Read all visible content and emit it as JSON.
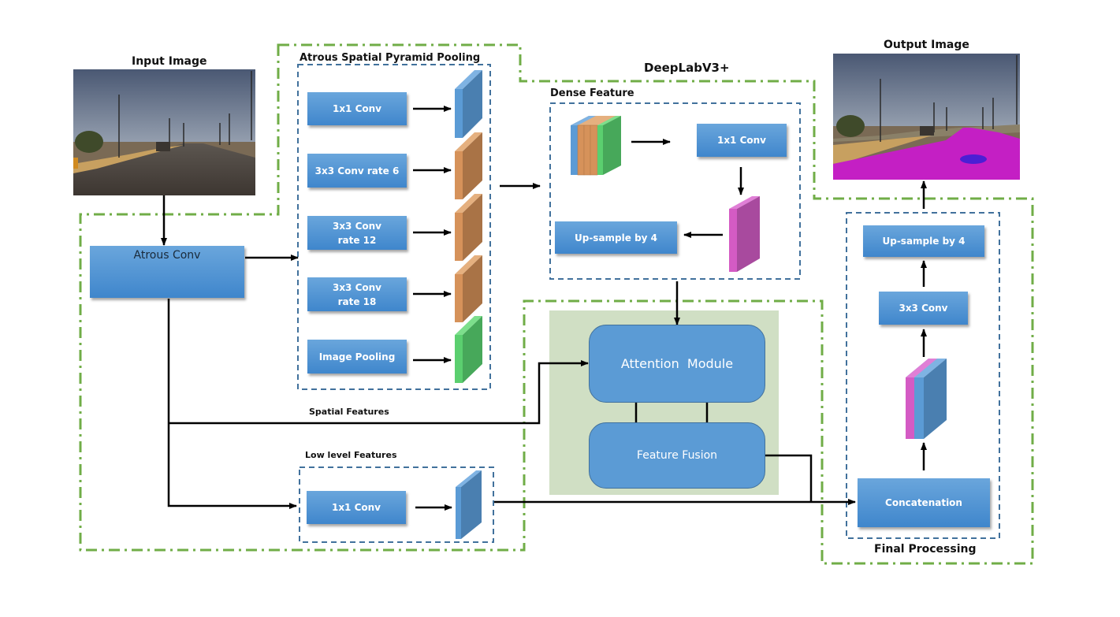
{
  "title": "DeepLabV3+",
  "input": {
    "label": "Input Image"
  },
  "output": {
    "label": "Output Image"
  },
  "encoder": {
    "atrous_conv": {
      "label": "Atrous Conv"
    },
    "aspp": {
      "label": "Atrous Spatial Pyramid Pooling",
      "branches": [
        {
          "label_lines": [
            "1x1 Conv"
          ],
          "feature_color": "#5b9bd5"
        },
        {
          "label_lines": [
            "3x3 Conv rate 6"
          ],
          "feature_color": "#d6925a"
        },
        {
          "label_lines": [
            "3x3 Conv",
            "rate 12"
          ],
          "feature_color": "#d6925a"
        },
        {
          "label_lines": [
            "3x3 Conv",
            "rate 18"
          ],
          "feature_color": "#d6925a"
        },
        {
          "label_lines": [
            "Image Pooling"
          ],
          "feature_color": "#5bcf6f"
        }
      ]
    },
    "dense_feature": {
      "label": "Dense Feature",
      "conv_label": "1x1 Conv",
      "upsample_label": "Up-sample by 4"
    },
    "spatial_features_label": "Spatial Features",
    "low_level": {
      "label": "Low level Features",
      "conv_label": "1x1 Conv"
    }
  },
  "attention": {
    "module_label": "Attention  Module",
    "fusion_label": "Feature Fusion"
  },
  "final": {
    "label": "Final Processing",
    "concat_label": "Concatenation",
    "conv_label": "3x3 Conv",
    "upsample_label": "Up-sample by 4"
  },
  "colors": {
    "outline_green": "#70ad47",
    "dash_blue": "#41719c",
    "box_blue": "#5b9bd5",
    "orange": "#d6925a",
    "green": "#5bcf6f",
    "magenta": "#d45bc4",
    "attention_bg": "#d0dfc4",
    "segment_magenta": "#c41fc4"
  }
}
